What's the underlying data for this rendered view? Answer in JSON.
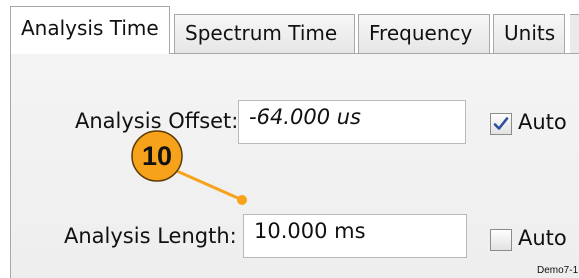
{
  "tabs": [
    {
      "label": "Analysis Time",
      "active": true
    },
    {
      "label": "Spectrum Time",
      "active": false
    },
    {
      "label": "Frequency",
      "active": false
    },
    {
      "label": "Units",
      "active": false
    }
  ],
  "analysis_offset": {
    "label": "Analysis Offset:",
    "value": "-64.000 us",
    "auto_label": "Auto",
    "auto_checked": true
  },
  "analysis_length": {
    "label": "Analysis Length:",
    "value": "10.000 ms",
    "auto_label": "Auto",
    "auto_checked": false
  },
  "callout": {
    "number": "10",
    "color": "#f7a21b"
  },
  "figure_id": "Demo7-1",
  "colors": {
    "panel": "#f1f1f1",
    "border": "#a8a8a8",
    "check": "#2c4f9e"
  }
}
